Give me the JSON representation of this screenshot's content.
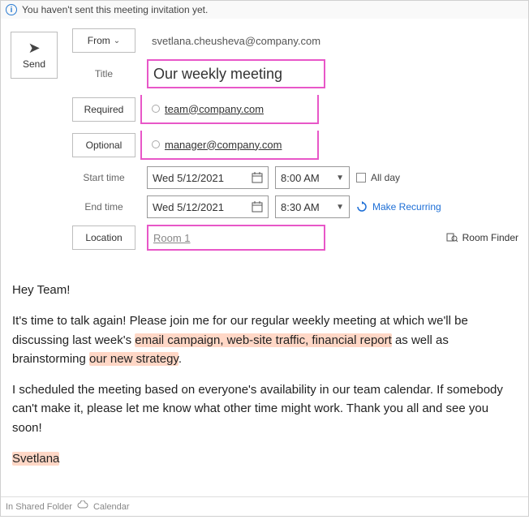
{
  "info_bar": {
    "message": "You haven't sent this meeting invitation yet."
  },
  "send": {
    "label": "Send"
  },
  "from": {
    "label": "From",
    "value": "svetlana.cheusheva@company.com"
  },
  "title": {
    "label": "Title",
    "value": "Our weekly meeting"
  },
  "required": {
    "label": "Required",
    "attendee": "team@company.com"
  },
  "optional": {
    "label": "Optional",
    "attendee": "manager@company.com"
  },
  "start": {
    "label": "Start time",
    "date": "Wed 5/12/2021",
    "time": "8:00 AM"
  },
  "end": {
    "label": "End time",
    "date": "Wed 5/12/2021",
    "time": "8:30 AM"
  },
  "allday": {
    "label": "All day"
  },
  "recurring": {
    "label": "Make Recurring"
  },
  "location": {
    "label": "Location",
    "value": "Room 1"
  },
  "room_finder": {
    "label": "Room Finder"
  },
  "body": {
    "greeting": "Hey Team!",
    "p1a": "It's time to talk again! Please join me for our regular weekly meeting at which we'll be discussing last week's ",
    "h1": "email campaign, web-site traffic, financial report",
    "p1b": " as well as brainstorming ",
    "h2": "our new strategy",
    "p1c": ".",
    "p2": "I scheduled the meeting based on everyone's availability in our team calendar. If somebody can't make it, please let me know what other time might work. Thank you all and see you soon!",
    "signoff": "Svetlana"
  },
  "footer": {
    "folder_label": "In Shared Folder",
    "folder_name": "Calendar"
  }
}
